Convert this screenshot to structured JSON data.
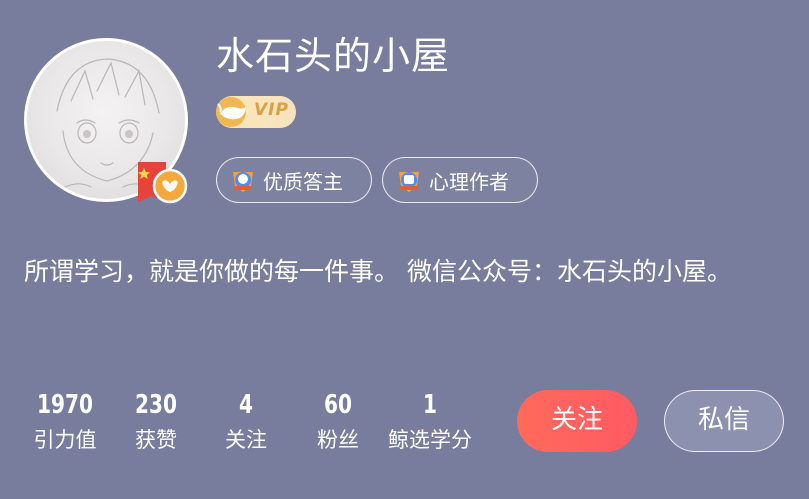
{
  "profile": {
    "username": "水石头的小屋",
    "vip_label": "VIP",
    "bio": "所谓学习，就是你做的每一件事。 微信公众号：水石头的小屋。"
  },
  "tags": [
    {
      "label": "优质答主",
      "icon": "medal-icon"
    },
    {
      "label": "心理作者",
      "icon": "medal-icon"
    }
  ],
  "stats": [
    {
      "value": "1970",
      "label": "引力值"
    },
    {
      "value": "230",
      "label": "获赞"
    },
    {
      "value": "4",
      "label": "关注"
    },
    {
      "value": "60",
      "label": "粉丝"
    },
    {
      "value": "1",
      "label": "鲸选学分"
    }
  ],
  "actions": {
    "follow_label": "关注",
    "message_label": "私信"
  },
  "colors": {
    "background": "#787d9d",
    "follow_button": "#ff5f5f",
    "vip_text": "#d9a044"
  }
}
